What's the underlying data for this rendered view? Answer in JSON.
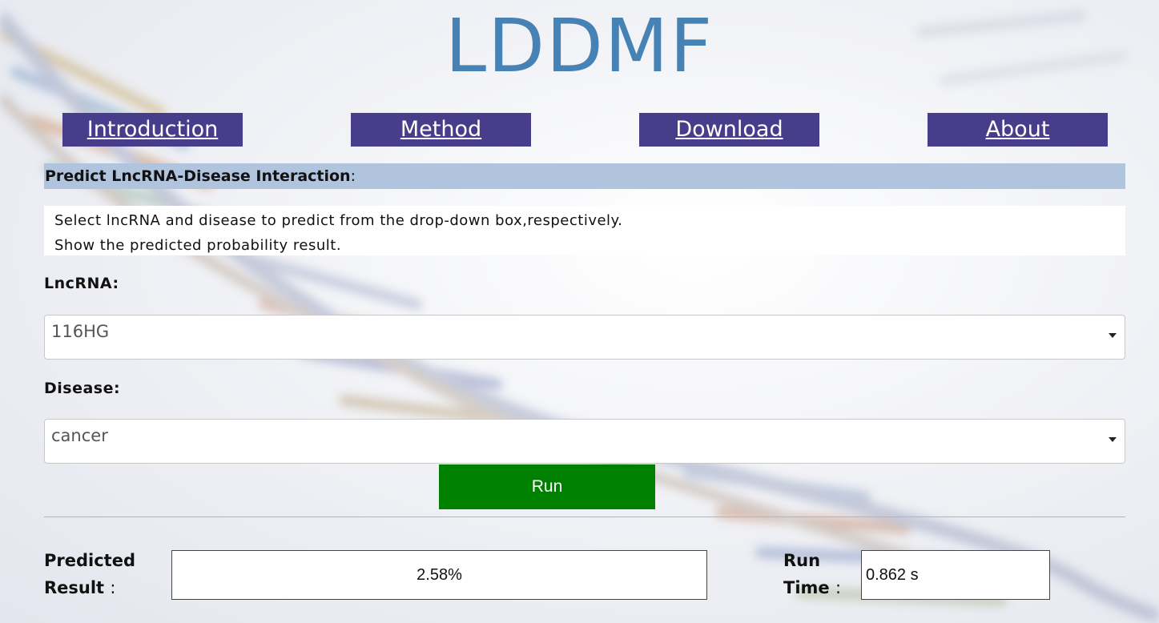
{
  "app": {
    "title": "LDDMF"
  },
  "nav": {
    "items": [
      {
        "label": "Introduction"
      },
      {
        "label": "Method"
      },
      {
        "label": "Download"
      },
      {
        "label": "About"
      }
    ]
  },
  "predict": {
    "header": "Predict LncRNA-Disease Interaction",
    "header_colon": ":",
    "description": [
      "Select lncRNA and disease to predict from the drop-down box,respectively.",
      "Show the predicted probability result."
    ],
    "lncrna": {
      "label": "LncRNA:",
      "selected": "116HG"
    },
    "disease": {
      "label": "Disease:",
      "selected": "cancer"
    },
    "run_label": "Run"
  },
  "result": {
    "predicted_label_line1": "Predicted",
    "predicted_label_line2": "Result",
    "predicted_colon": ":",
    "predicted_value": "2.58%",
    "runtime_label_line1": "Run",
    "runtime_label_line2": "Time",
    "runtime_colon": ":",
    "runtime_value": "0.862 s"
  },
  "colors": {
    "logo": "#4682b4",
    "nav_bg": "#483d8b",
    "section_header_bg": "#b0c4de",
    "run_button": "#008000"
  }
}
